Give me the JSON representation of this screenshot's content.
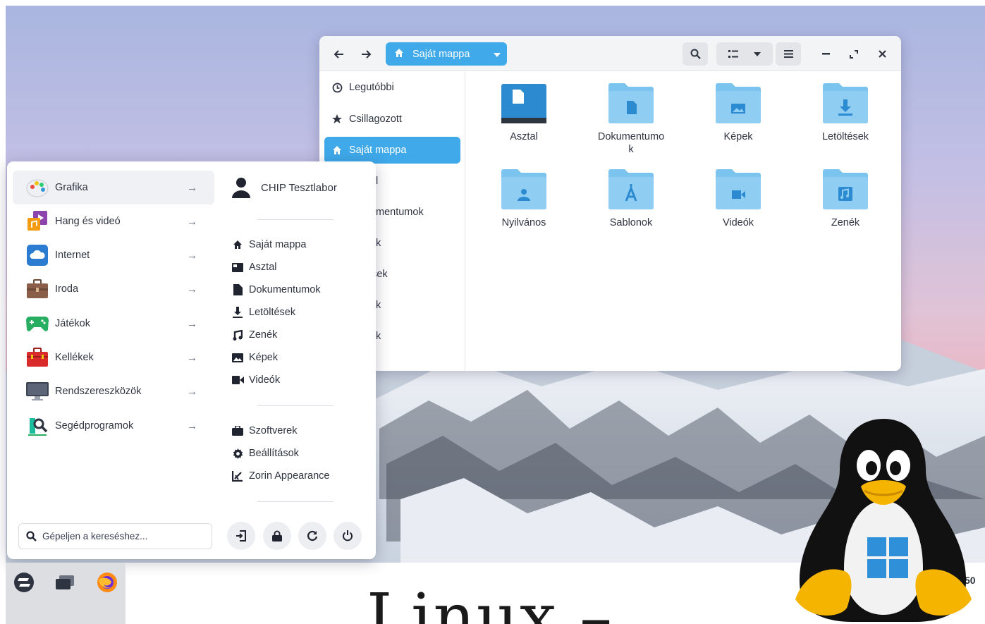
{
  "files": {
    "path_label": "Saját mappa",
    "sidebar": [
      {
        "label": "Legutóbbi",
        "icon": "clock-icon"
      },
      {
        "label": "Csillagozott",
        "icon": "star-icon"
      },
      {
        "label": "Saját mappa",
        "icon": "home-icon"
      },
      {
        "label": "l",
        "icon": "none"
      },
      {
        "label": "mentumok",
        "icon": "none"
      },
      {
        "label": "k",
        "icon": "none"
      },
      {
        "label": "ések",
        "icon": "none"
      },
      {
        "label": "k",
        "icon": "none"
      },
      {
        "label": "k",
        "icon": "none"
      }
    ],
    "items": [
      {
        "label": "Asztal",
        "icon": "desktop-folder-icon"
      },
      {
        "label": "Dokumentumo\nk",
        "icon": "documents-folder-icon"
      },
      {
        "label": "Képek",
        "icon": "pictures-folder-icon"
      },
      {
        "label": "Letöltések",
        "icon": "downloads-folder-icon"
      },
      {
        "label": "Nyilvános",
        "icon": "public-folder-icon"
      },
      {
        "label": "Sablonok",
        "icon": "templates-folder-icon"
      },
      {
        "label": "Videók",
        "icon": "videos-folder-icon"
      },
      {
        "label": "Zenék",
        "icon": "music-folder-icon"
      }
    ]
  },
  "menu": {
    "categories": [
      {
        "label": "Grafika",
        "icon": "graphics-icon"
      },
      {
        "label": "Hang és videó",
        "icon": "sound-video-icon"
      },
      {
        "label": "Internet",
        "icon": "internet-icon"
      },
      {
        "label": "Iroda",
        "icon": "office-icon"
      },
      {
        "label": "Játékok",
        "icon": "games-icon"
      },
      {
        "label": "Kellékek",
        "icon": "accessories-icon"
      },
      {
        "label": "Rendszereszközök",
        "icon": "system-tools-icon"
      },
      {
        "label": "Segédprogramok",
        "icon": "utilities-icon"
      }
    ],
    "user": "CHIP Tesztlabor",
    "places": [
      {
        "label": "Saját mappa",
        "icon": "home-icon"
      },
      {
        "label": "Asztal",
        "icon": "desktop-icon"
      },
      {
        "label": "Dokumentumok",
        "icon": "document-icon"
      },
      {
        "label": "Letöltések",
        "icon": "download-icon"
      },
      {
        "label": "Zenék",
        "icon": "music-icon"
      },
      {
        "label": "Képek",
        "icon": "image-icon"
      },
      {
        "label": "Videók",
        "icon": "video-icon"
      }
    ],
    "system": [
      {
        "label": "Szoftverek",
        "icon": "software-icon"
      },
      {
        "label": "Beállítások",
        "icon": "settings-icon"
      },
      {
        "label": "Zorin Appearance",
        "icon": "appearance-icon"
      }
    ],
    "search_placeholder": "Gépeljen a kereséshez..."
  },
  "headline": "Linux –",
  "clock_fragment": "50",
  "colors": {
    "accent": "#3fa9ea",
    "folder": "#7cc4f0",
    "folder_dark": "#4fa9e6"
  }
}
